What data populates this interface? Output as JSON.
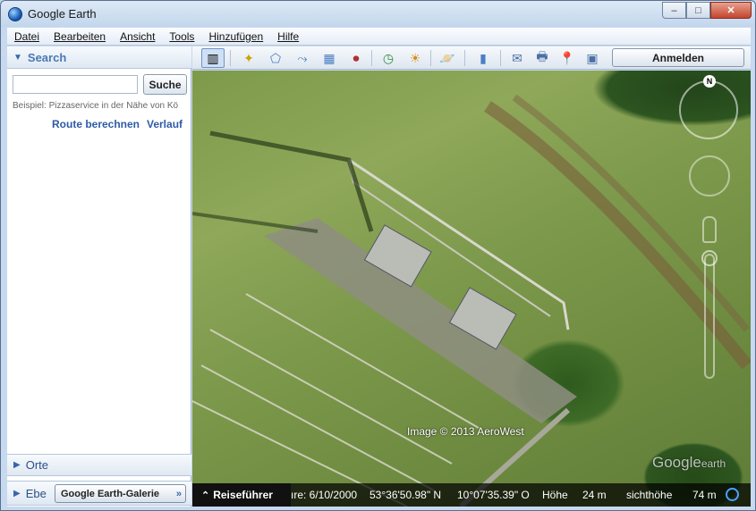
{
  "window": {
    "title": "Google Earth",
    "minimize_label": "–",
    "maximize_label": "□",
    "close_label": "✕"
  },
  "menu": {
    "items": [
      "Datei",
      "Bearbeiten",
      "Ansicht",
      "Tools",
      "Hinzufügen",
      "Hilfe"
    ]
  },
  "left_panel": {
    "search_title": "Search",
    "search_input_value": "",
    "search_button": "Suche",
    "example_text": "Beispiel: Pizzaservice in der Nähe von Kö",
    "route_link": "Route berechnen",
    "history_link": "Verlauf",
    "places_title": "Orte",
    "layers_title": "Ebe",
    "gallery_button": "Google Earth-Galerie",
    "gallery_chevron": "»"
  },
  "toolbar": {
    "icons": [
      "sidebar-toggle-icon",
      "placemark-icon",
      "polygon-icon",
      "path-icon",
      "image-overlay-icon",
      "record-tour-icon",
      "historical-imagery-icon",
      "sunlight-icon",
      "planets-icon",
      "ruler-icon",
      "email-icon",
      "print-icon",
      "google-maps-icon",
      "save-image-icon"
    ],
    "glyphs": [
      "▥",
      "✦",
      "⬠",
      "⤳",
      "▦",
      "⏺",
      "◷",
      "☀",
      "🪐",
      "▮",
      "✉",
      "🖶",
      "📍",
      "▣"
    ],
    "signin_label": "Anmelden"
  },
  "map": {
    "imagery_credit": "Image © 2013 AeroWest",
    "watermark": "Google",
    "watermark_suffix": "earth",
    "compass_label": "N"
  },
  "statusbar": {
    "tour_guide_label": "Reiseführer",
    "tour_guide_glyph": "⌃",
    "imagery_date": "ıre: 6/10/2000",
    "latitude": "53°36'50.98\" N",
    "longitude": "10°07'35.39\" O",
    "elevation_label": "Höhe",
    "elevation_value": "24 m",
    "eye_alt_label": "sichthöhe",
    "eye_alt_value": "74 m"
  }
}
